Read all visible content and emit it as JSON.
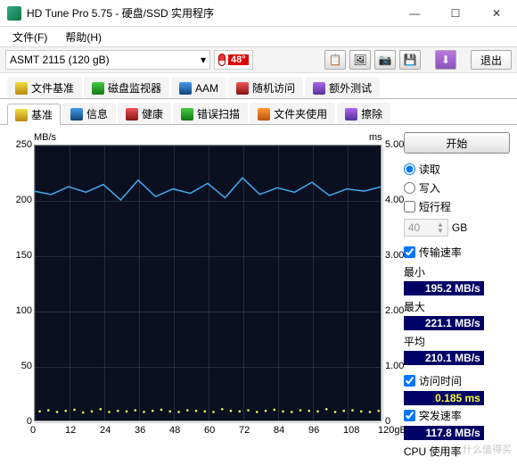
{
  "window": {
    "title": "HD Tune Pro 5.75 - 硬盘/SSD 实用程序"
  },
  "menu": {
    "file": "文件(F)",
    "help": "帮助(H)"
  },
  "toolbar": {
    "drive": "ASMT    2115 (120 gB)",
    "temp": "48°",
    "exit": "退出"
  },
  "tabs": {
    "row1": [
      {
        "label": "文件基准",
        "icon": "yellow-icon"
      },
      {
        "label": "磁盘监视器",
        "icon": "green-icon"
      },
      {
        "label": "AAM",
        "icon": "blue-icon"
      },
      {
        "label": "随机访问",
        "icon": "red-icon"
      },
      {
        "label": "额外测试",
        "icon": "purple-icon"
      }
    ],
    "row2": [
      {
        "label": "基准",
        "icon": "yellow-icon",
        "active": true
      },
      {
        "label": "信息",
        "icon": "blue-icon"
      },
      {
        "label": "健康",
        "icon": "red-icon"
      },
      {
        "label": "错误扫描",
        "icon": "green-icon"
      },
      {
        "label": "文件夹使用",
        "icon": "orange-icon"
      },
      {
        "label": "擦除",
        "icon": "purple-icon"
      }
    ]
  },
  "side": {
    "start": "开始",
    "read": "读取",
    "write": "写入",
    "short": "短行程",
    "short_val": "40",
    "short_unit": "GB",
    "transfer": "传输速率",
    "min_label": "最小",
    "min_val": "195.2 MB/s",
    "max_label": "最大",
    "max_val": "221.1 MB/s",
    "avg_label": "平均",
    "avg_val": "210.1 MB/s",
    "access_label": "访问时间",
    "access_val": "0.185 ms",
    "burst_label": "突发速率",
    "burst_val": "117.8 MB/s",
    "cpu_label": "CPU 使用率"
  },
  "chart": {
    "y_unit": "MB/s",
    "y2_unit": "ms",
    "y_ticks": [
      "250",
      "200",
      "150",
      "100",
      "50",
      "0"
    ],
    "y2_ticks": [
      "5.00",
      "4.00",
      "3.00",
      "2.00",
      "1.00",
      "0"
    ],
    "x_ticks": [
      "0",
      "12",
      "24",
      "36",
      "48",
      "60",
      "72",
      "84",
      "96",
      "108",
      "120gB"
    ]
  },
  "chart_data": {
    "type": "line",
    "title": "",
    "xlabel": "gB",
    "ylabel": "MB/s",
    "y2label": "ms",
    "xlim": [
      0,
      120
    ],
    "ylim": [
      0,
      250
    ],
    "y2lim": [
      0,
      5.0
    ],
    "series": [
      {
        "name": "Transfer rate (MB/s)",
        "axis": "y",
        "x": [
          0,
          6,
          12,
          18,
          24,
          30,
          36,
          42,
          48,
          54,
          60,
          66,
          72,
          78,
          84,
          90,
          96,
          102,
          108,
          114,
          120
        ],
        "values": [
          208,
          205,
          212,
          207,
          214,
          200,
          218,
          203,
          210,
          206,
          215,
          202,
          220,
          205,
          211,
          207,
          216,
          204,
          210,
          208,
          212
        ]
      },
      {
        "name": "Access time (ms)",
        "axis": "y2",
        "type": "scatter",
        "x": [
          2,
          5,
          8,
          11,
          14,
          17,
          20,
          23,
          26,
          29,
          32,
          35,
          38,
          41,
          44,
          47,
          50,
          53,
          56,
          59,
          62,
          65,
          68,
          71,
          74,
          77,
          80,
          83,
          86,
          89,
          92,
          95,
          98,
          101,
          104,
          107,
          110,
          113,
          116,
          119
        ],
        "values": [
          0.18,
          0.2,
          0.17,
          0.19,
          0.21,
          0.16,
          0.18,
          0.22,
          0.17,
          0.19,
          0.18,
          0.2,
          0.17,
          0.19,
          0.21,
          0.18,
          0.17,
          0.2,
          0.19,
          0.18,
          0.17,
          0.22,
          0.19,
          0.18,
          0.2,
          0.17,
          0.19,
          0.21,
          0.18,
          0.17,
          0.2,
          0.19,
          0.18,
          0.22,
          0.17,
          0.19,
          0.2,
          0.18,
          0.17,
          0.19
        ]
      }
    ]
  },
  "watermark": "什么值得买"
}
